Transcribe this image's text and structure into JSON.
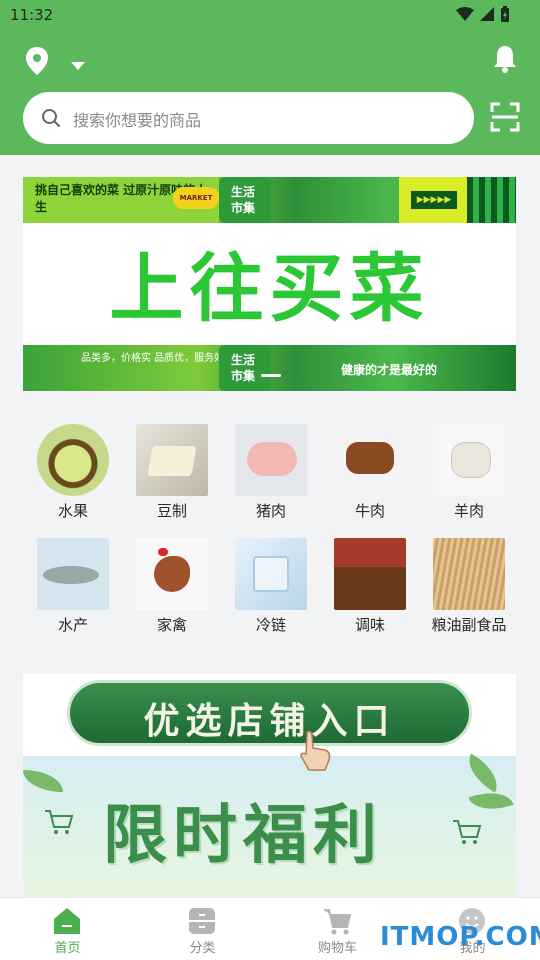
{
  "status_bar": {
    "time": "11:32"
  },
  "header": {
    "location_icon": "location-pin-icon",
    "caret_icon": "caret-down-icon",
    "bell_icon": "bell-icon",
    "scan_icon": "scan-icon",
    "brand_color": "#5cb85c"
  },
  "search": {
    "placeholder": "搜索你想要的商品"
  },
  "banner": {
    "top_strip_text": "挑自己喜欢的菜 过原汁原味的人生",
    "market_badge": "MARKET",
    "center_badge": "生活 市集",
    "arrows": "▶▶▶▶▶",
    "title": "上往买菜",
    "bottom_strip_text": "品类多，价格实 品质优，服务好",
    "bottom_strip_slogan": "健康的才是最好的"
  },
  "categories": [
    {
      "label": "水果"
    },
    {
      "label": "豆制"
    },
    {
      "label": "猪肉"
    },
    {
      "label": "牛肉"
    },
    {
      "label": "羊肉"
    },
    {
      "label": "水产"
    },
    {
      "label": "家禽"
    },
    {
      "label": "冷链"
    },
    {
      "label": "调味"
    },
    {
      "label": "粮油副食品"
    }
  ],
  "promo": {
    "entry_label": "优选店铺入口",
    "main_text": "限时福利"
  },
  "bottom_nav": [
    {
      "label": "首页",
      "icon": "home-icon",
      "active": true
    },
    {
      "label": "分类",
      "icon": "category-icon",
      "active": false
    },
    {
      "label": "购物车",
      "icon": "cart-icon",
      "active": false
    },
    {
      "label": "我的",
      "icon": "profile-icon",
      "active": false
    }
  ],
  "watermark": "ITMOP.COM",
  "colors": {
    "active": "#4cae4c",
    "inactive": "#8a8a8a"
  }
}
